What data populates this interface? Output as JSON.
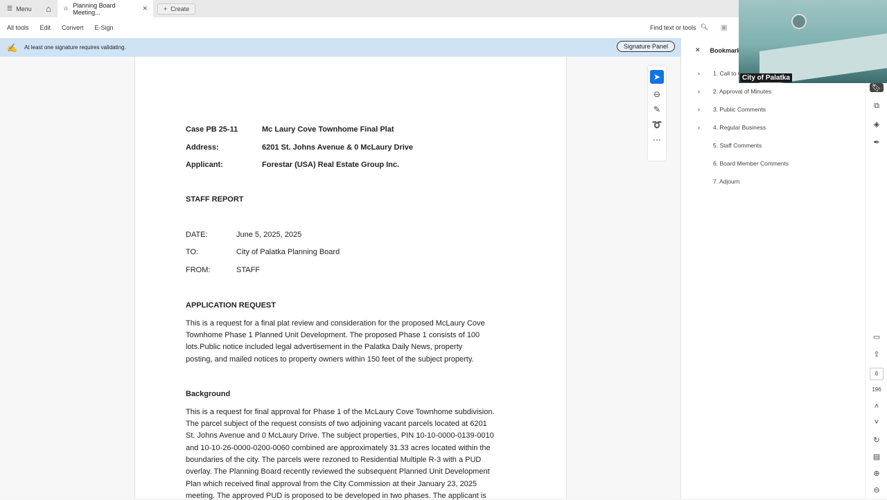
{
  "tabbar": {
    "menu": "Menu",
    "tab_title": "Planning Board Meeting...",
    "create": "Create"
  },
  "toolbar": {
    "items": [
      "All tools",
      "Edit",
      "Convert",
      "E-Sign"
    ],
    "find": "Find text or tools"
  },
  "notice": {
    "text": "At least one signature requires validating.",
    "button": "Signature Panel"
  },
  "document": {
    "case_label": "Case PB 25-11",
    "case_value": "Mc Laury Cove Townhome Final  Plat",
    "address_label": "Address:",
    "address_value": "6201 St. Johns Avenue & 0 McLaury Drive",
    "applicant_label": "Applicant:",
    "applicant_value": "Forestar (USA) Real Estate Group Inc.",
    "staff_report": "STAFF REPORT",
    "date_label": "DATE:",
    "date_value": "June 5, 2025, 2025",
    "to_label": "TO:",
    "to_value": "City of Palatka Planning Board",
    "from_label": "FROM:",
    "from_value": "STAFF",
    "app_request_heading": "APPLICATION REQUEST",
    "app_request_lines": [
      "This is a request for a final plat review and consideration for the proposed McLaury Cove",
      "Townhome Phase 1 Planned Unit Development. The proposed Phase 1 consists of 100",
      "lots.Public notice included legal advertisement in the Palatka Daily News, property",
      "posting, and mailed notices to property owners within 150 feet of the subject property."
    ],
    "background_heading": "Background",
    "background_lines": [
      "This is a request for final approval for Phase 1 of the McLaury Cove Townhome subdivision.",
      "The parcel subject of the request consists of two adjoining vacant parcels located at 6201",
      "St. Johns Avenue and 0 McLaury Drive. The subject properties, PIN 10-10-0000-0139-0010",
      "and 10-10-26-0000-0200-0060 combined are approximately 31.33 acres located within the",
      "boundaries of the city. The parcels were rezoned to Residential Multiple R-3 with a PUD",
      "overlay. The Planning Board recently reviewed the subsequent Planned Unit Development",
      "Plan which received final approval from the City Commission at their January 23, 2025",
      "meeting. The approved PUD is proposed to be developed in two phases. The applicant is"
    ]
  },
  "bookmarks": {
    "title": "Bookmarks",
    "items": [
      {
        "label": "1. Call to Order",
        "expandable": true
      },
      {
        "label": "2. Approval of Minutes",
        "expandable": true
      },
      {
        "label": "3. Public Comments",
        "expandable": true
      },
      {
        "label": "4. Regular Business",
        "expandable": true
      },
      {
        "label": "5. Staff Comments",
        "expandable": false
      },
      {
        "label": "6. Board Member Comments",
        "expandable": false
      },
      {
        "label": "7. Adjourn",
        "expandable": false
      }
    ]
  },
  "page_nav": {
    "current": "6",
    "total": "196"
  },
  "video": {
    "caption": "City of Palatka"
  }
}
